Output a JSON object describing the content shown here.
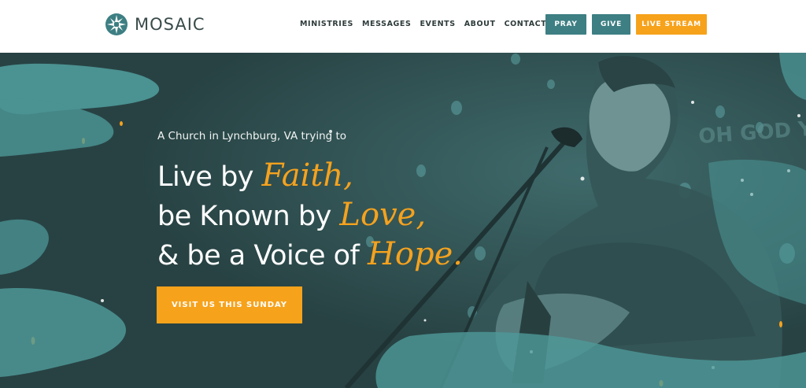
{
  "brand": {
    "name": "MOSAIC",
    "logo_icon": "mosaic-logo-icon"
  },
  "nav": {
    "links": [
      "MINISTRIES",
      "MESSAGES",
      "EVENTS",
      "ABOUT",
      "CONTACT"
    ]
  },
  "header_buttons": {
    "pray": "PRAY",
    "give": "GIVE",
    "live": "LIVE STREAM"
  },
  "hero": {
    "tagline": "A Church in Lynchburg, VA trying to",
    "line1_prefix": "Live by ",
    "line1_script": "Faith,",
    "line2_prefix": "be Known by ",
    "line2_script": "Love,",
    "line3_prefix": "& be a Voice of ",
    "line3_script": "Hope.",
    "cta": "VISIT US THIS SUNDAY",
    "backdrop_text": "OH GOD YO",
    "image": "worship-leader-singing-photo"
  },
  "colors": {
    "teal": "#3d7f83",
    "orange": "#f7a21b",
    "hero_dark": "#2d4a4b",
    "brush_teal": "#4f9a9a"
  }
}
